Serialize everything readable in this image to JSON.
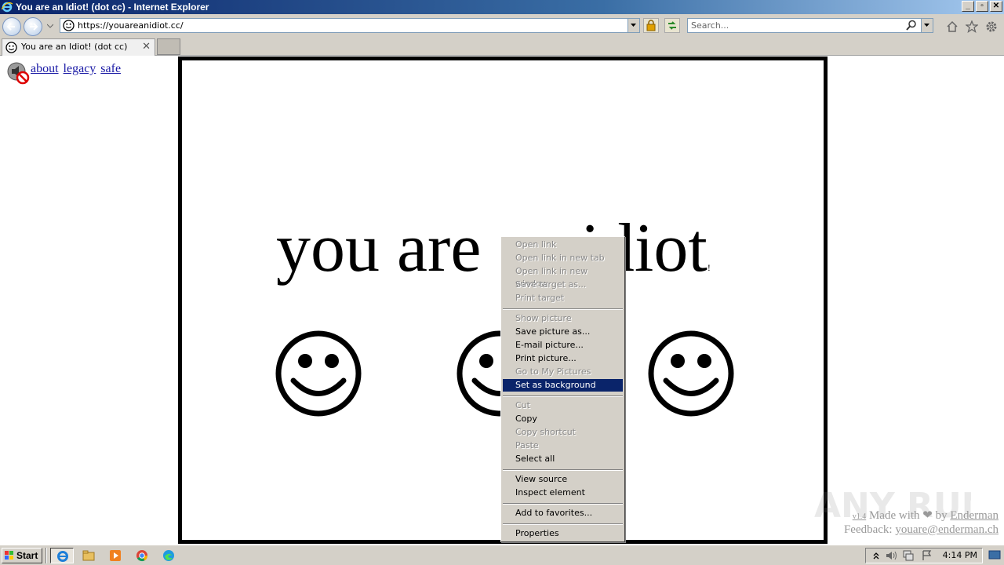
{
  "window": {
    "title": "You are an Idiot! (dot cc) - Internet Explorer",
    "minimize": "_",
    "restore": "▫",
    "close": "✕"
  },
  "navbar": {
    "url": "https://youareanidiot.cc/",
    "search_placeholder": "Search..."
  },
  "tabs": [
    {
      "label": "You are an Idiot! (dot cc)",
      "close": "✕"
    }
  ],
  "page": {
    "links": [
      "about",
      "legacy",
      "safe"
    ],
    "headline": "you are an idiot",
    "headline_suffix": "!",
    "credits": {
      "version": "v1.4",
      "made_with": "Made with",
      "heart": "❤",
      "by": "by",
      "author": "Enderman",
      "feedback_label": "Feedback:",
      "email": "youare@enderman.ch"
    },
    "watermark": "ANY RUN"
  },
  "context_menu": {
    "groups": [
      [
        {
          "label": "Open link",
          "enabled": false
        },
        {
          "label": "Open link in new tab",
          "enabled": false
        },
        {
          "label": "Open link in new window",
          "enabled": false
        },
        {
          "label": "Save target as...",
          "enabled": false
        },
        {
          "label": "Print target",
          "enabled": false
        }
      ],
      [
        {
          "label": "Show picture",
          "enabled": false
        },
        {
          "label": "Save picture as...",
          "enabled": true
        },
        {
          "label": "E-mail picture...",
          "enabled": true
        },
        {
          "label": "Print picture...",
          "enabled": true
        },
        {
          "label": "Go to My Pictures",
          "enabled": false
        },
        {
          "label": "Set as background",
          "enabled": true,
          "highlighted": true
        }
      ],
      [
        {
          "label": "Cut",
          "enabled": false
        },
        {
          "label": "Copy",
          "enabled": true
        },
        {
          "label": "Copy shortcut",
          "enabled": false
        },
        {
          "label": "Paste",
          "enabled": false
        },
        {
          "label": "Select all",
          "enabled": true
        }
      ],
      [
        {
          "label": "View source",
          "enabled": true
        },
        {
          "label": "Inspect element",
          "enabled": true
        }
      ],
      [
        {
          "label": "Add to favorites...",
          "enabled": true
        }
      ],
      [
        {
          "label": "Properties",
          "enabled": true
        }
      ]
    ]
  },
  "taskbar": {
    "start_label": "Start",
    "clock": "4:14 PM",
    "apps": [
      "ie-icon",
      "explorer-icon",
      "media-player-icon",
      "chrome-icon",
      "edge-icon"
    ]
  },
  "colors": {
    "menu_highlight": "#0a246a",
    "link": "#1a1aa6",
    "title_gradient_start": "#0a246a"
  }
}
